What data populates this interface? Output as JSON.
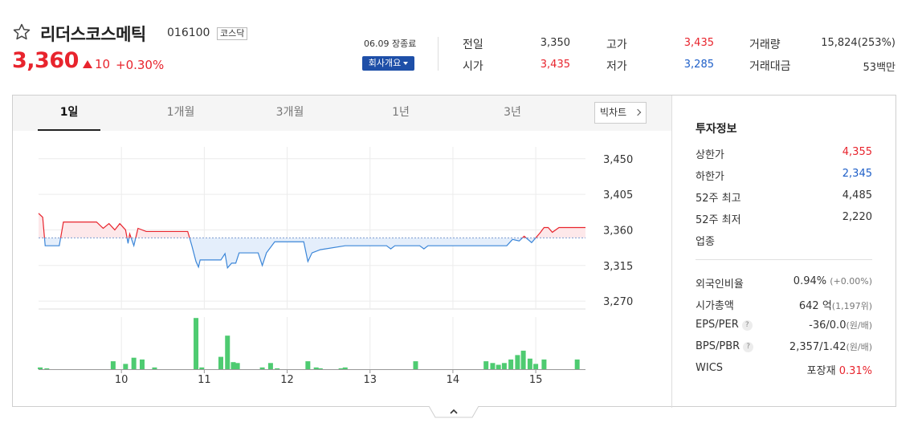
{
  "stock": {
    "name": "리더스코스메틱",
    "code": "016100",
    "market": "코스닥",
    "price": "3,360",
    "change": "10",
    "change_pct": "+0.30%",
    "session": "06.09 장종료",
    "company_button": "회사개요"
  },
  "summary": [
    {
      "label": "전일",
      "value": "3,350",
      "tone": "normal"
    },
    {
      "label": "고가",
      "value": "3,435",
      "tone": "red"
    },
    {
      "label": "거래량",
      "value": "15,824(253%)",
      "tone": "normal"
    },
    {
      "label": "시가",
      "value": "3,435",
      "tone": "red"
    },
    {
      "label": "저가",
      "value": "3,285",
      "tone": "blue"
    },
    {
      "label": "거래대금",
      "value": "53백만",
      "tone": "normal"
    }
  ],
  "tabs": [
    "1일",
    "1개월",
    "3개월",
    "1년",
    "3년"
  ],
  "active_tab": "1일",
  "big_chart_button": "빅차트",
  "colors": {
    "up": "#e8242d",
    "down": "#1e5fc8",
    "volume": "#4ecb71",
    "accent_button": "#1e4fa8"
  },
  "chart_data": {
    "type": "line",
    "baseline": 3350,
    "ylim": [
      3260,
      3465
    ],
    "yticks": [
      "3,450",
      "3,405",
      "3,360",
      "3,315",
      "3,270"
    ],
    "ytick_values": [
      3450,
      3405,
      3360,
      3315,
      3270
    ],
    "xtick_labels": [
      "10",
      "11",
      "12",
      "13",
      "14",
      "15"
    ],
    "xtick_positions": [
      10,
      11,
      12,
      13,
      14,
      15
    ],
    "xlim": [
      9.0,
      15.6
    ],
    "price_series": [
      [
        9.0,
        3381
      ],
      [
        9.05,
        3376
      ],
      [
        9.08,
        3340
      ],
      [
        9.25,
        3340
      ],
      [
        9.3,
        3370
      ],
      [
        9.7,
        3370
      ],
      [
        9.78,
        3362
      ],
      [
        9.85,
        3368
      ],
      [
        9.92,
        3360
      ],
      [
        9.98,
        3368
      ],
      [
        10.05,
        3360
      ],
      [
        10.08,
        3343
      ],
      [
        10.1,
        3355
      ],
      [
        10.15,
        3340
      ],
      [
        10.2,
        3362
      ],
      [
        10.3,
        3358
      ],
      [
        10.8,
        3358
      ],
      [
        10.85,
        3340
      ],
      [
        10.9,
        3320
      ],
      [
        10.93,
        3313
      ],
      [
        10.95,
        3322
      ],
      [
        11.2,
        3322
      ],
      [
        11.25,
        3330
      ],
      [
        11.28,
        3312
      ],
      [
        11.33,
        3318
      ],
      [
        11.38,
        3318
      ],
      [
        11.42,
        3331
      ],
      [
        11.65,
        3331
      ],
      [
        11.7,
        3315
      ],
      [
        11.75,
        3331
      ],
      [
        11.85,
        3345
      ],
      [
        12.2,
        3345
      ],
      [
        12.25,
        3320
      ],
      [
        12.3,
        3331
      ],
      [
        12.4,
        3335
      ],
      [
        12.7,
        3340
      ],
      [
        13.2,
        3340
      ],
      [
        13.25,
        3336
      ],
      [
        13.3,
        3340
      ],
      [
        13.6,
        3340
      ],
      [
        13.65,
        3336
      ],
      [
        13.7,
        3340
      ],
      [
        14.65,
        3340
      ],
      [
        14.72,
        3348
      ],
      [
        14.8,
        3346
      ],
      [
        14.86,
        3352
      ],
      [
        14.95,
        3344
      ],
      [
        15.05,
        3356
      ],
      [
        15.1,
        3363
      ],
      [
        15.15,
        3363
      ],
      [
        15.2,
        3357
      ],
      [
        15.28,
        3363
      ],
      [
        15.6,
        3363
      ]
    ],
    "volume_series": [
      [
        9.02,
        2
      ],
      [
        9.1,
        1
      ],
      [
        9.9,
        9
      ],
      [
        10.05,
        6
      ],
      [
        10.15,
        13
      ],
      [
        10.25,
        11
      ],
      [
        10.4,
        2
      ],
      [
        10.9,
        58
      ],
      [
        10.97,
        2
      ],
      [
        11.2,
        14
      ],
      [
        11.28,
        38
      ],
      [
        11.35,
        8
      ],
      [
        11.4,
        7
      ],
      [
        11.7,
        2
      ],
      [
        11.8,
        7
      ],
      [
        11.88,
        1
      ],
      [
        12.25,
        9
      ],
      [
        12.35,
        2
      ],
      [
        12.4,
        1
      ],
      [
        12.65,
        1
      ],
      [
        12.7,
        2
      ],
      [
        13.55,
        9
      ],
      [
        14.4,
        9
      ],
      [
        14.48,
        7
      ],
      [
        14.55,
        5
      ],
      [
        14.62,
        7
      ],
      [
        14.7,
        11
      ],
      [
        14.78,
        16
      ],
      [
        14.85,
        21
      ],
      [
        14.93,
        12
      ],
      [
        15.0,
        6
      ],
      [
        15.1,
        11
      ],
      [
        15.5,
        11
      ]
    ]
  },
  "investment": {
    "title": "투자정보",
    "rows_top": [
      {
        "label": "상한가",
        "value": "4,355",
        "tone": "red",
        "sub": ""
      },
      {
        "label": "하한가",
        "value": "2,345",
        "tone": "blue",
        "sub": ""
      },
      {
        "label": "52주 최고",
        "value": "4,485",
        "tone": "normal",
        "sub": ""
      },
      {
        "label": "52주 최저",
        "value": "2,220",
        "tone": "normal",
        "sub": ""
      },
      {
        "label": "업종",
        "value": "",
        "tone": "normal",
        "sub": ""
      }
    ],
    "rows_bottom": [
      {
        "label": "외국인비율",
        "value": "0.94%",
        "sub": "(+0.00%)",
        "help": false
      },
      {
        "label": "시가총액",
        "value": "642 억",
        "sub": "(1,197위)",
        "help": false
      },
      {
        "label": "EPS/PER",
        "value": "-36/0.0",
        "sub": "(원/배)",
        "help": true
      },
      {
        "label": "BPS/PBR",
        "value": "2,357/1.42",
        "sub": "(원/배)",
        "help": true
      },
      {
        "label": "WICS",
        "value": "포장재",
        "sub": "0.31%",
        "help": false
      }
    ]
  }
}
